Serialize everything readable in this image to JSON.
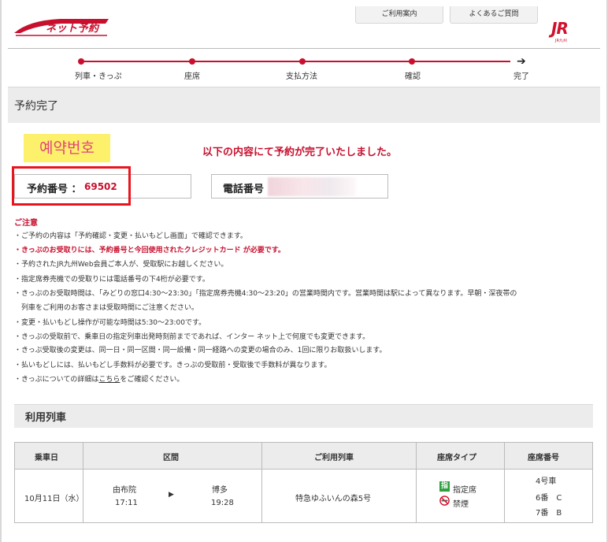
{
  "header": {
    "logo_text": "ネット予約",
    "nav_guide": "ご利用案内",
    "nav_faq": "よくあるご質問",
    "brand": "JR",
    "brand_sub": "JR九州"
  },
  "progress": {
    "steps": [
      "列車・きっぷ",
      "座席",
      "支払方法",
      "確認",
      "完了"
    ]
  },
  "page": {
    "title": "予約完了",
    "annotation": "예약번호",
    "complete_message": "以下の内容にて予約が完了いたしました。",
    "reservation_label": "予約番号 ：",
    "reservation_number": "69502",
    "phone_label": "電話番号"
  },
  "notes": {
    "title": "ご注意",
    "items": [
      "・ご予約の内容は「予約確認・変更・払いもどし画面」で確認できます。",
      "・きっぷのお受取りには、予約番号と今回使用されたクレジットカード が必要です。",
      "・予約されたJR九州Web会員ご本人が、受取駅にお越しください。",
      "・指定席券売機での受取りには電話番号の下4桁が必要です。",
      "・きっぷのお受取時間は、「みどりの窓口4:30～23:30」「指定席券売機4:30～23:20」の営業時間内です。営業時間は駅によって異なります。早朝・深夜帯の",
      "　列車をご利用のお客さまは受取時間にご注意ください。",
      "・変更・払いもどし操作が可能な時間は5:30～23:00です。",
      "・きっぷの受取前で、乗車日の指定列車出発時刻前までであれば、インター ネット上で何度でも変更できます。",
      "・きっぷ受取後の変更は、同一日・同一区間・同一設備・同一経路への変更の場合のみ、1回に限りお取扱いします。",
      "・払いもどしには、払いもどし手数料が必要です。きっぷの受取前・受取後で手数料が異なります。"
    ],
    "last_prefix": "・きっぷについての詳細は",
    "last_link": "こちら",
    "last_suffix": "をご確認ください。"
  },
  "train": {
    "section_title": "利用列車",
    "columns": [
      "乗車日",
      "区間",
      "ご利用列車",
      "座席タイプ",
      "座席番号"
    ],
    "row": {
      "date": "10月11日（水）",
      "from_station": "由布院",
      "from_time": "17:11",
      "arrow": "▶",
      "to_station": "博多",
      "to_time": "19:28",
      "train_name": "特急ゆふいんの森5号",
      "seat_type_icon_char": "指",
      "seat_type": "指定席",
      "smoking": "禁煙",
      "car": "4号車",
      "seats": [
        "6番　C",
        "7番　B"
      ]
    }
  },
  "colors": {
    "accent": "#c8102e",
    "highlight": "#e8141e",
    "header_bg": "#ececec"
  }
}
